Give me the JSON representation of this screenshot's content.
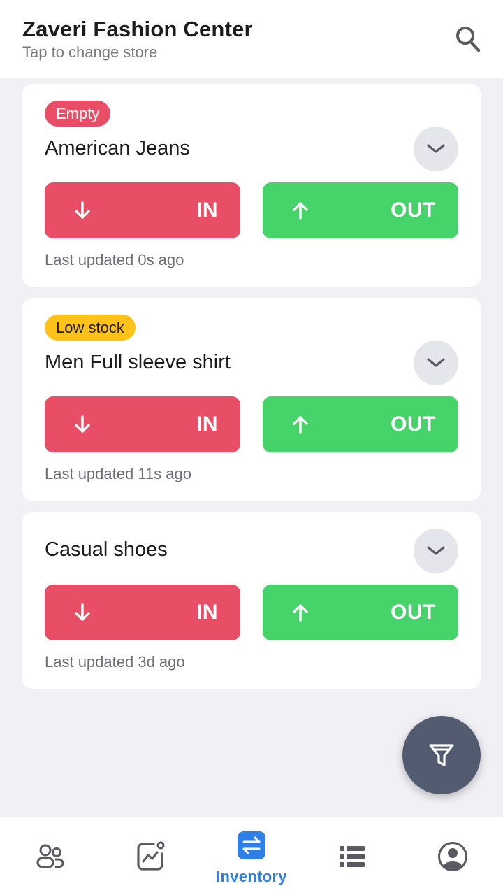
{
  "header": {
    "store_name": "Zaveri Fashion Center",
    "store_subtitle": "Tap to change store",
    "search_icon": "search-icon"
  },
  "items": [
    {
      "badge": "Empty",
      "badge_type": "empty",
      "name": "American Jeans",
      "in_label": "IN",
      "out_label": "OUT",
      "updated": "Last updated 0s ago"
    },
    {
      "badge": "Low stock",
      "badge_type": "low",
      "name": "Men Full sleeve shirt",
      "in_label": "IN",
      "out_label": "OUT",
      "updated": "Last updated 11s ago"
    },
    {
      "name": "Casual shoes",
      "in_label": "IN",
      "out_label": "OUT",
      "updated": "Last updated 3d ago"
    }
  ],
  "fab": {
    "icon": "filter-icon"
  },
  "bottom_nav": {
    "items": [
      {
        "icon": "users-icon"
      },
      {
        "icon": "trend-chart-icon"
      },
      {
        "icon": "transfer-icon",
        "label": "Inventory",
        "active": true
      },
      {
        "icon": "list-icon"
      },
      {
        "icon": "profile-icon"
      }
    ]
  },
  "colors": {
    "in_red": "#e84f67",
    "out_green": "#45d36a",
    "low_stock_yellow": "#ffc21a",
    "accent_blue": "#2f80e6",
    "fab_slate": "#525b70",
    "background": "#f0f0f5"
  }
}
